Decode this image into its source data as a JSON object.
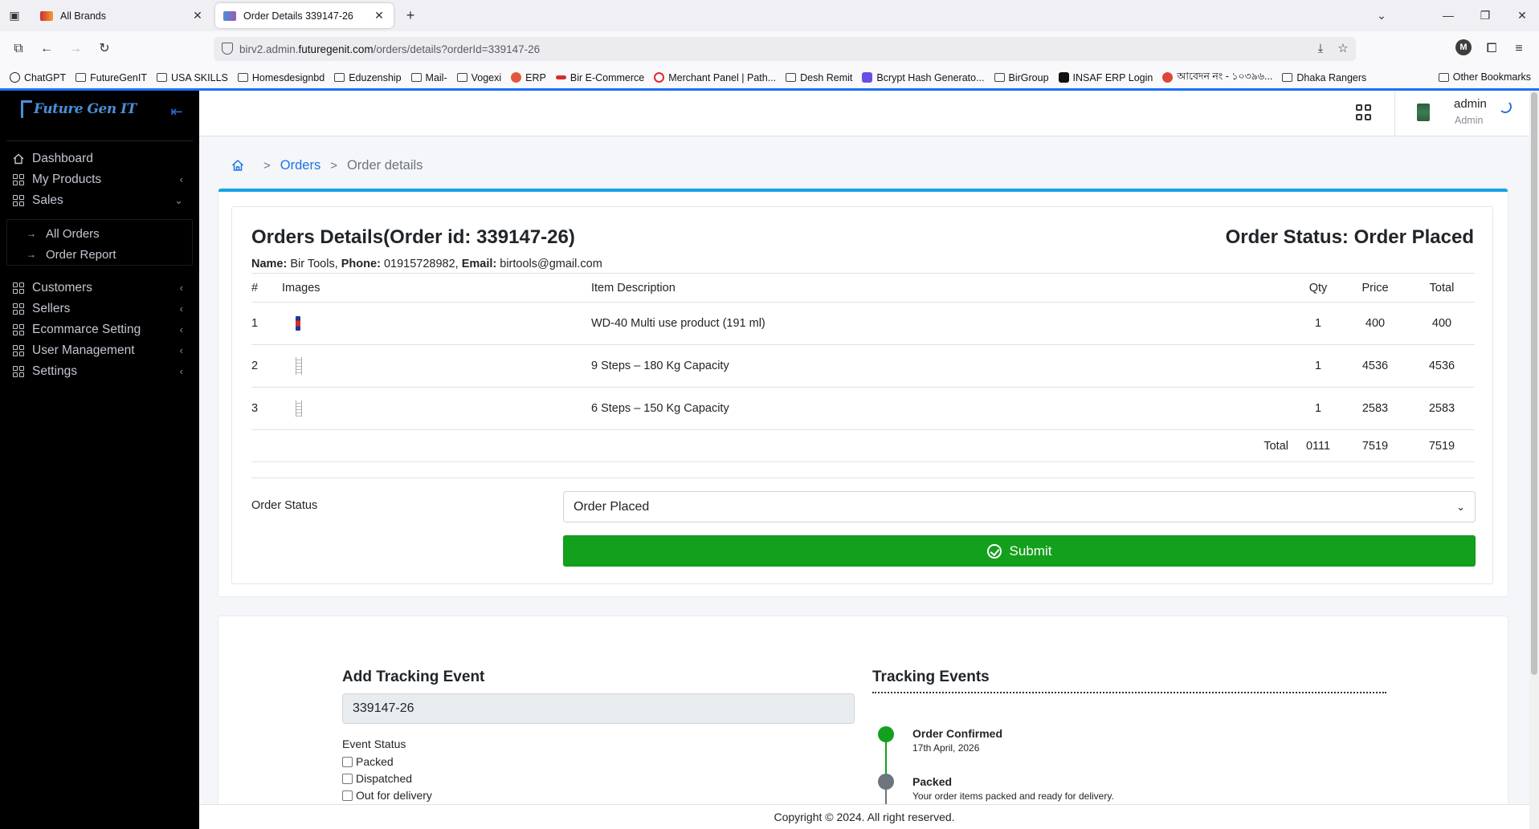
{
  "browser": {
    "tabs": [
      {
        "label": "All Brands",
        "active": false
      },
      {
        "label": "Order Details 339147-26",
        "active": true
      }
    ],
    "url_prefix": "birv2.admin.",
    "url_host": "futuregenit.com",
    "url_path": "/orders/details?orderId=339147-26",
    "bookmarks": [
      "ChatGPT",
      "FutureGenIT",
      "USA SKILLS",
      "Homesdesignbd",
      "Eduzenship",
      "Mail-",
      "Vogexi",
      "ERP",
      "Bir E-Commerce",
      "Merchant Panel | Path...",
      "Desh Remit",
      "Bcrypt Hash Generato...",
      "BirGroup",
      "INSAF ERP Login",
      "আবেদন নং - ১০৩৯৬...",
      "Dhaka Rangers"
    ],
    "other_bookmarks": "Other Bookmarks",
    "profile_initial": "M"
  },
  "sidebar": {
    "brand": "Future Gen IT",
    "items": [
      {
        "label": "Dashboard"
      },
      {
        "label": "My Products"
      },
      {
        "label": "Sales"
      },
      {
        "label": "Customers"
      },
      {
        "label": "Sellers"
      },
      {
        "label": "Ecommarce Setting"
      },
      {
        "label": "User Management"
      },
      {
        "label": "Settings"
      }
    ],
    "sales_sub": [
      "All Orders",
      "Order Report"
    ]
  },
  "header": {
    "user_name": "admin",
    "user_role": "Admin"
  },
  "breadcrumb": {
    "link": "Orders",
    "current": "Order details"
  },
  "order": {
    "title": "Orders Details(Order id: 339147-26)",
    "status_title": "Order Status: Order Placed",
    "name_label": "Name:",
    "name": "Bir Tools",
    "phone_label": "Phone:",
    "phone": "01915728982",
    "email_label": "Email:",
    "email": "birtools@gmail.com",
    "columns": {
      "num": "#",
      "images": "Images",
      "desc": "Item Description",
      "qty": "Qty",
      "price": "Price",
      "total": "Total"
    },
    "items": [
      {
        "num": "1",
        "desc": "WD-40 Multi use product (191 ml)",
        "qty": "1",
        "price": "400",
        "total": "400"
      },
      {
        "num": "2",
        "desc": "9 Steps – 180 Kg Capacity",
        "qty": "1",
        "price": "4536",
        "total": "4536"
      },
      {
        "num": "3",
        "desc": "6 Steps – 150 Kg Capacity",
        "qty": "1",
        "price": "2583",
        "total": "2583"
      }
    ],
    "totals": {
      "label": "Total",
      "qty": "0111",
      "price": "7519",
      "total": "7519"
    },
    "status_label": "Order Status",
    "status_value": "Order Placed",
    "submit_label": "Submit"
  },
  "tracking": {
    "add_title": "Add Tracking Event",
    "order_id_value": "339147-26",
    "event_status_label": "Event Status",
    "event_options": [
      "Packed",
      "Dispatched",
      "Out for delivery"
    ],
    "events_title": "Tracking Events",
    "events": [
      {
        "title": "Order Confirmed",
        "sub": "17th April, 2026"
      },
      {
        "title": "Packed",
        "sub": "Your order items packed and ready for delivery."
      }
    ]
  },
  "footer": {
    "text": "Copyright © 2024. All right reserved."
  }
}
